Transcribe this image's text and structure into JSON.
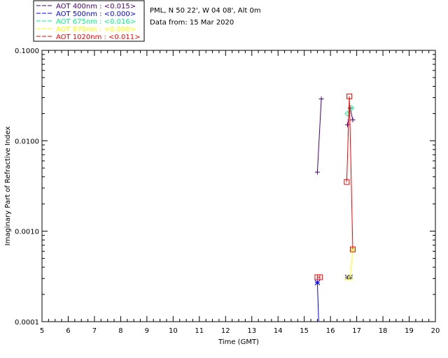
{
  "chart_data": {
    "type": "scatter",
    "title_lines": [
      "PML, N 50 22', W 04 08', Alt 0m",
      "Data from: 15 Mar 2020"
    ],
    "xlabel": "Time (GMT)",
    "ylabel": "Imaginary Part of Refractive Index",
    "xlim": [
      5,
      20
    ],
    "ylim": [
      0.0001,
      0.1
    ],
    "yscale": "log",
    "xticks": [
      5,
      6,
      7,
      8,
      9,
      10,
      11,
      12,
      13,
      14,
      15,
      16,
      17,
      18,
      19,
      20
    ],
    "yticks": [
      {
        "value": 0.0001,
        "label": "0.0001"
      },
      {
        "value": 0.001,
        "label": "0.0010"
      },
      {
        "value": 0.01,
        "label": "0.0100"
      },
      {
        "value": 0.1,
        "label": "0.1000"
      }
    ],
    "legend_position": "top-left outside",
    "series": [
      {
        "name": "AOT  400nm : <0.015>",
        "color": "#4b0082",
        "marker": "plus",
        "x": [
          15.5,
          15.65,
          16.65,
          16.75,
          16.85
        ],
        "y": [
          0.0045,
          0.029,
          0.015,
          0.023,
          0.017
        ]
      },
      {
        "name": "AOT  500nm : <0.000>",
        "color": "#0000ff",
        "marker": "star",
        "x": [
          15.5,
          15.55,
          16.65,
          16.75
        ],
        "y": [
          0.00027,
          8e-05,
          0.00031,
          0.00031
        ]
      },
      {
        "name": "AOT  675nm : <0.016>",
        "color": "#00ff7f",
        "marker": "diamond",
        "x": [
          16.65,
          16.8
        ],
        "y": [
          0.02,
          0.023
        ]
      },
      {
        "name": "AOT  870nm : <0.000>",
        "color": "#ffff00",
        "marker": "triangle",
        "x": [
          16.65,
          16.75,
          16.85
        ],
        "y": [
          0.00031,
          0.00031,
          0.00063
        ]
      },
      {
        "name": "AOT 1020nm : <0.011>",
        "color": "#ff0000",
        "marker": "square",
        "x": [
          15.5,
          15.6,
          16.62,
          16.72,
          16.85
        ],
        "y": [
          0.00031,
          0.00031,
          0.0035,
          0.031,
          0.00063
        ]
      }
    ]
  }
}
